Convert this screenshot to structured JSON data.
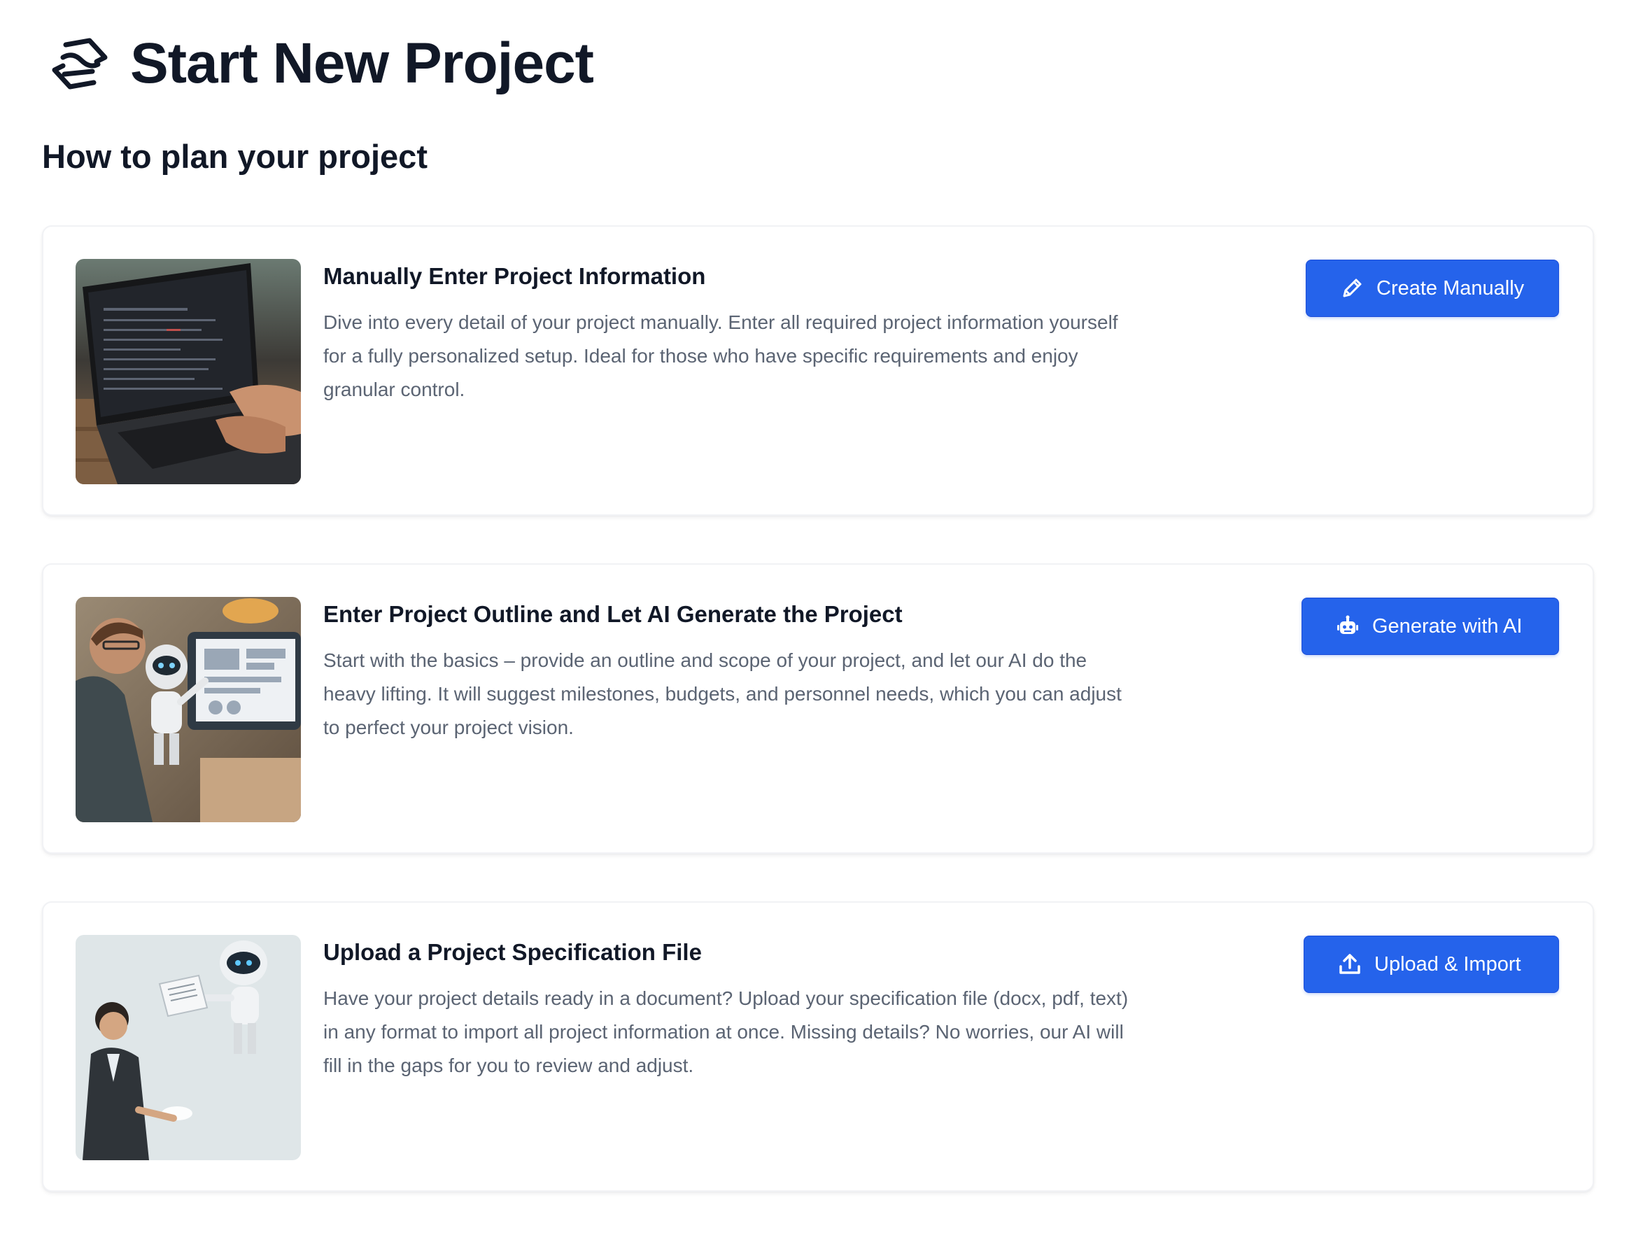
{
  "header": {
    "logo_icon": "hexagon-swirl-logo-icon",
    "title": "Start New Project"
  },
  "section": {
    "title": "How to plan your project"
  },
  "cards": [
    {
      "image": "laptop-code-photo",
      "title": "Manually Enter Project Information",
      "description": "Dive into every detail of your project manually. Enter all required project information yourself for a fully personalized setup. Ideal for those who have specific requirements and enjoy granular control.",
      "button_label": "Create Manually",
      "button_icon": "pencil-icon"
    },
    {
      "image": "robot-presenting-to-developer-photo",
      "title": "Enter Project Outline and Let AI Generate the Project",
      "description": "Start with the basics – provide an outline and scope of your project, and let our AI do the heavy lifting. It will suggest milestones, budgets, and personnel needs, which you can adjust to perfect your project vision.",
      "button_label": "Generate with AI",
      "button_icon": "robot-icon"
    },
    {
      "image": "robot-handing-document-photo",
      "title": "Upload a Project Specification File",
      "description": "Have your project details ready in a document? Upload your specification file (docx, pdf, text) in any format to import all project information at once. Missing details? No worries, our AI will fill in the gaps for you to review and adjust.",
      "button_label": "Upload & Import",
      "button_icon": "upload-icon"
    }
  ],
  "colors": {
    "primary_button": "#2563eb",
    "title_text": "#111827",
    "body_text": "#5b6473",
    "card_border": "#f1f2f5"
  }
}
